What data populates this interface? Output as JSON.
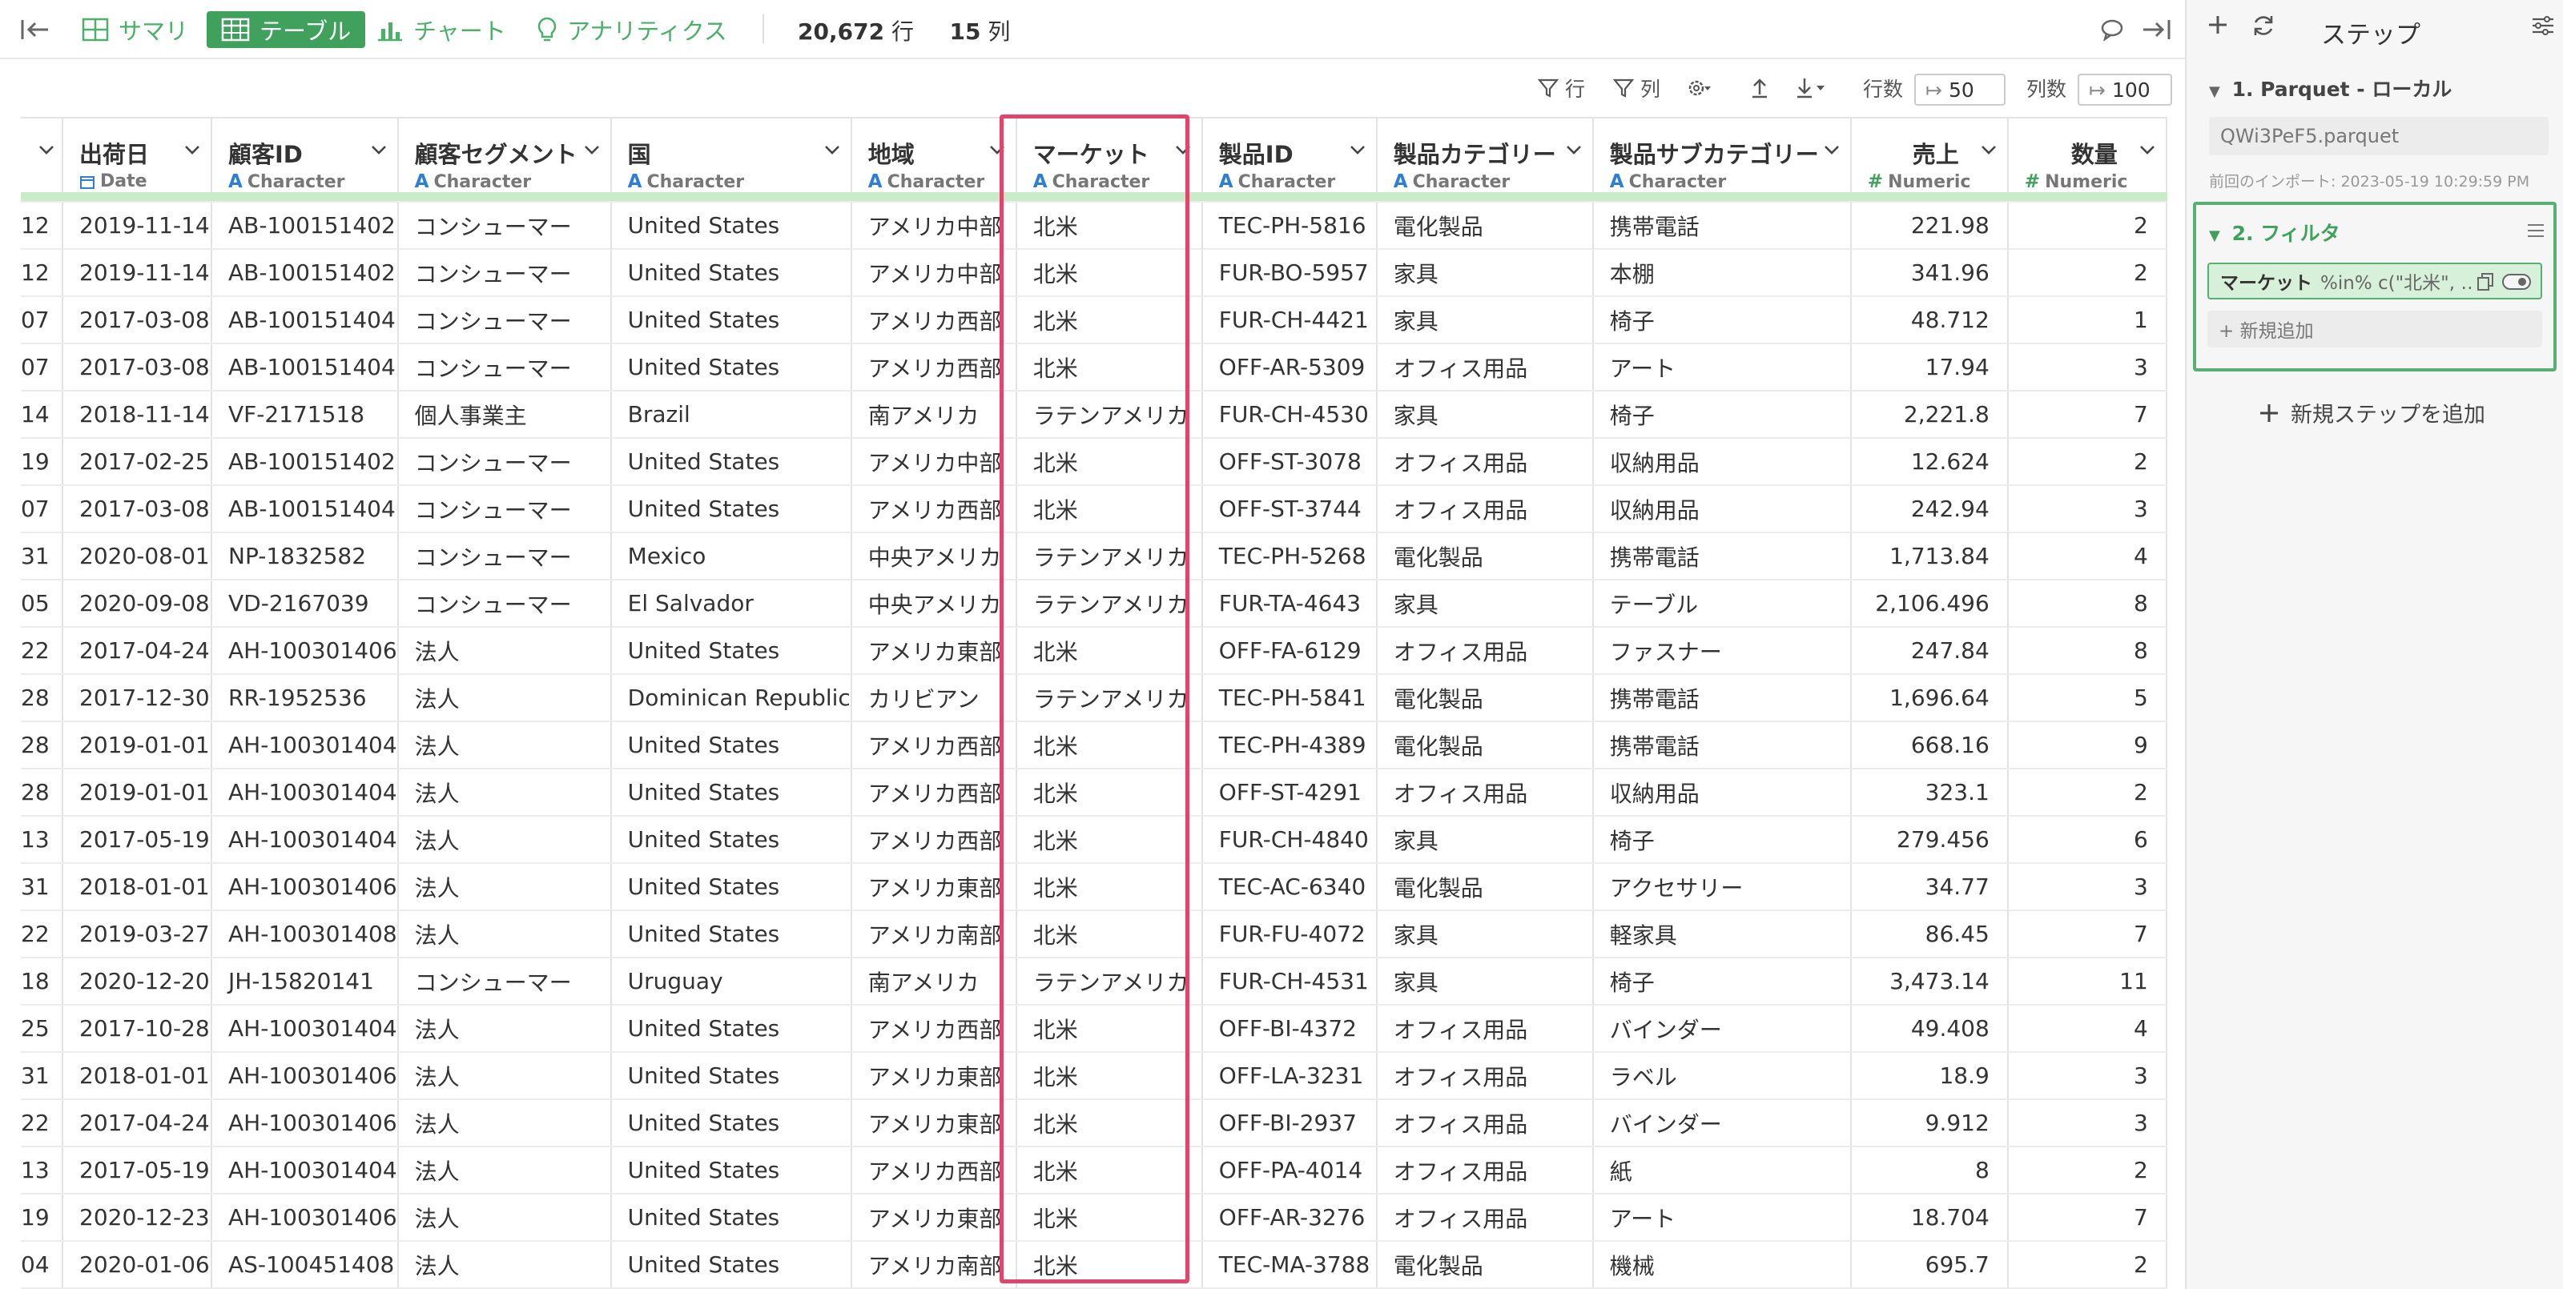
{
  "toolbar": {
    "tabs": [
      {
        "label": "サマリ",
        "icon": "grid-icon"
      },
      {
        "label": "テーブル",
        "icon": "table-icon",
        "active": true
      },
      {
        "label": "チャート",
        "icon": "bar-chart-icon"
      },
      {
        "label": "アナリティクス",
        "icon": "lightbulb-icon"
      }
    ],
    "row_count": "20,672",
    "row_unit": "行",
    "col_count": "15",
    "col_unit": "列"
  },
  "subbar": {
    "row_filter": "行",
    "col_filter": "列",
    "rows_label": "行数",
    "rows_value": "50",
    "cols_label": "列数",
    "cols_value": "100"
  },
  "table": {
    "columns": [
      {
        "name": "",
        "type": "",
        "kind": "none"
      },
      {
        "name": "出荷日",
        "type": "Date",
        "kind": "date"
      },
      {
        "name": "顧客ID",
        "type": "Character",
        "kind": "char"
      },
      {
        "name": "顧客セグメント",
        "type": "Character",
        "kind": "char"
      },
      {
        "name": "国",
        "type": "Character",
        "kind": "char"
      },
      {
        "name": "地域",
        "type": "Character",
        "kind": "char"
      },
      {
        "name": "マーケット",
        "type": "Character",
        "kind": "char"
      },
      {
        "name": "製品ID",
        "type": "Character",
        "kind": "char"
      },
      {
        "name": "製品カテゴリー",
        "type": "Character",
        "kind": "char"
      },
      {
        "name": "製品サブカテゴリー",
        "type": "Character",
        "kind": "char"
      },
      {
        "name": "売上",
        "type": "Numeric",
        "kind": "num"
      },
      {
        "name": "数量",
        "type": "Numeric",
        "kind": "num"
      }
    ],
    "rows": [
      [
        "12",
        "2019-11-14",
        "AB-100151402",
        "コンシューマー",
        "United States",
        "アメリカ中部",
        "北米",
        "TEC-PH-5816",
        "電化製品",
        "携帯電話",
        "221.98",
        "2"
      ],
      [
        "12",
        "2019-11-14",
        "AB-100151402",
        "コンシューマー",
        "United States",
        "アメリカ中部",
        "北米",
        "FUR-BO-5957",
        "家具",
        "本棚",
        "341.96",
        "2"
      ],
      [
        "07",
        "2017-03-08",
        "AB-100151404",
        "コンシューマー",
        "United States",
        "アメリカ西部",
        "北米",
        "FUR-CH-4421",
        "家具",
        "椅子",
        "48.712",
        "1"
      ],
      [
        "07",
        "2017-03-08",
        "AB-100151404",
        "コンシューマー",
        "United States",
        "アメリカ西部",
        "北米",
        "OFF-AR-5309",
        "オフィス用品",
        "アート",
        "17.94",
        "3"
      ],
      [
        "14",
        "2018-11-14",
        "VF-2171518",
        "個人事業主",
        "Brazil",
        "南アメリカ",
        "ラテンアメリカ",
        "FUR-CH-4530",
        "家具",
        "椅子",
        "2,221.8",
        "7"
      ],
      [
        "19",
        "2017-02-25",
        "AB-100151402",
        "コンシューマー",
        "United States",
        "アメリカ中部",
        "北米",
        "OFF-ST-3078",
        "オフィス用品",
        "収納用品",
        "12.624",
        "2"
      ],
      [
        "07",
        "2017-03-08",
        "AB-100151404",
        "コンシューマー",
        "United States",
        "アメリカ西部",
        "北米",
        "OFF-ST-3744",
        "オフィス用品",
        "収納用品",
        "242.94",
        "3"
      ],
      [
        "31",
        "2020-08-01",
        "NP-1832582",
        "コンシューマー",
        "Mexico",
        "中央アメリカ",
        "ラテンアメリカ",
        "TEC-PH-5268",
        "電化製品",
        "携帯電話",
        "1,713.84",
        "4"
      ],
      [
        "05",
        "2020-09-08",
        "VD-2167039",
        "コンシューマー",
        "El Salvador",
        "中央アメリカ",
        "ラテンアメリカ",
        "FUR-TA-4643",
        "家具",
        "テーブル",
        "2,106.496",
        "8"
      ],
      [
        "22",
        "2017-04-24",
        "AH-100301406",
        "法人",
        "United States",
        "アメリカ東部",
        "北米",
        "OFF-FA-6129",
        "オフィス用品",
        "ファスナー",
        "247.84",
        "8"
      ],
      [
        "28",
        "2017-12-30",
        "RR-1952536",
        "法人",
        "Dominican Republic",
        "カリビアン",
        "ラテンアメリカ",
        "TEC-PH-5841",
        "電化製品",
        "携帯電話",
        "1,696.64",
        "5"
      ],
      [
        "28",
        "2019-01-01",
        "AH-100301404",
        "法人",
        "United States",
        "アメリカ西部",
        "北米",
        "TEC-PH-4389",
        "電化製品",
        "携帯電話",
        "668.16",
        "9"
      ],
      [
        "28",
        "2019-01-01",
        "AH-100301404",
        "法人",
        "United States",
        "アメリカ西部",
        "北米",
        "OFF-ST-4291",
        "オフィス用品",
        "収納用品",
        "323.1",
        "2"
      ],
      [
        "13",
        "2017-05-19",
        "AH-100301404",
        "法人",
        "United States",
        "アメリカ西部",
        "北米",
        "FUR-CH-4840",
        "家具",
        "椅子",
        "279.456",
        "6"
      ],
      [
        "31",
        "2018-01-01",
        "AH-100301406",
        "法人",
        "United States",
        "アメリカ東部",
        "北米",
        "TEC-AC-6340",
        "電化製品",
        "アクセサリー",
        "34.77",
        "3"
      ],
      [
        "22",
        "2019-03-27",
        "AH-100301408",
        "法人",
        "United States",
        "アメリカ南部",
        "北米",
        "FUR-FU-4072",
        "家具",
        "軽家具",
        "86.45",
        "7"
      ],
      [
        "18",
        "2020-12-20",
        "JH-15820141",
        "コンシューマー",
        "Uruguay",
        "南アメリカ",
        "ラテンアメリカ",
        "FUR-CH-4531",
        "家具",
        "椅子",
        "3,473.14",
        "11"
      ],
      [
        "25",
        "2017-10-28",
        "AH-100301404",
        "法人",
        "United States",
        "アメリカ西部",
        "北米",
        "OFF-BI-4372",
        "オフィス用品",
        "バインダー",
        "49.408",
        "4"
      ],
      [
        "31",
        "2018-01-01",
        "AH-100301406",
        "法人",
        "United States",
        "アメリカ東部",
        "北米",
        "OFF-LA-3231",
        "オフィス用品",
        "ラベル",
        "18.9",
        "3"
      ],
      [
        "22",
        "2017-04-24",
        "AH-100301406",
        "法人",
        "United States",
        "アメリカ東部",
        "北米",
        "OFF-BI-2937",
        "オフィス用品",
        "バインダー",
        "9.912",
        "3"
      ],
      [
        "13",
        "2017-05-19",
        "AH-100301404",
        "法人",
        "United States",
        "アメリカ西部",
        "北米",
        "OFF-PA-4014",
        "オフィス用品",
        "紙",
        "8",
        "2"
      ],
      [
        "19",
        "2020-12-23",
        "AH-100301406",
        "法人",
        "United States",
        "アメリカ東部",
        "北米",
        "OFF-AR-3276",
        "オフィス用品",
        "アート",
        "18.704",
        "7"
      ],
      [
        "04",
        "2020-01-06",
        "AS-100451408",
        "法人",
        "United States",
        "アメリカ南部",
        "北米",
        "TEC-MA-3788",
        "電化製品",
        "機械",
        "695.7",
        "2"
      ]
    ]
  },
  "panel": {
    "title": "ステップ",
    "step1_title": "1. Parquet - ローカル",
    "step1_file": "QWi3PeF5.parquet",
    "step1_last_import": "前回のインポート: 2023-05-19 10:29:59 PM",
    "step2_title": "2. フィルタ",
    "filter_column": "マーケット",
    "filter_expr": "%in% c(\"北米\", …",
    "add_new": "+ 新規追加",
    "add_step": "新規ステップを追加"
  },
  "colors": {
    "accent": "#3fa15c",
    "highlight": "#e0456b",
    "char_type": "#2d7fd6"
  }
}
